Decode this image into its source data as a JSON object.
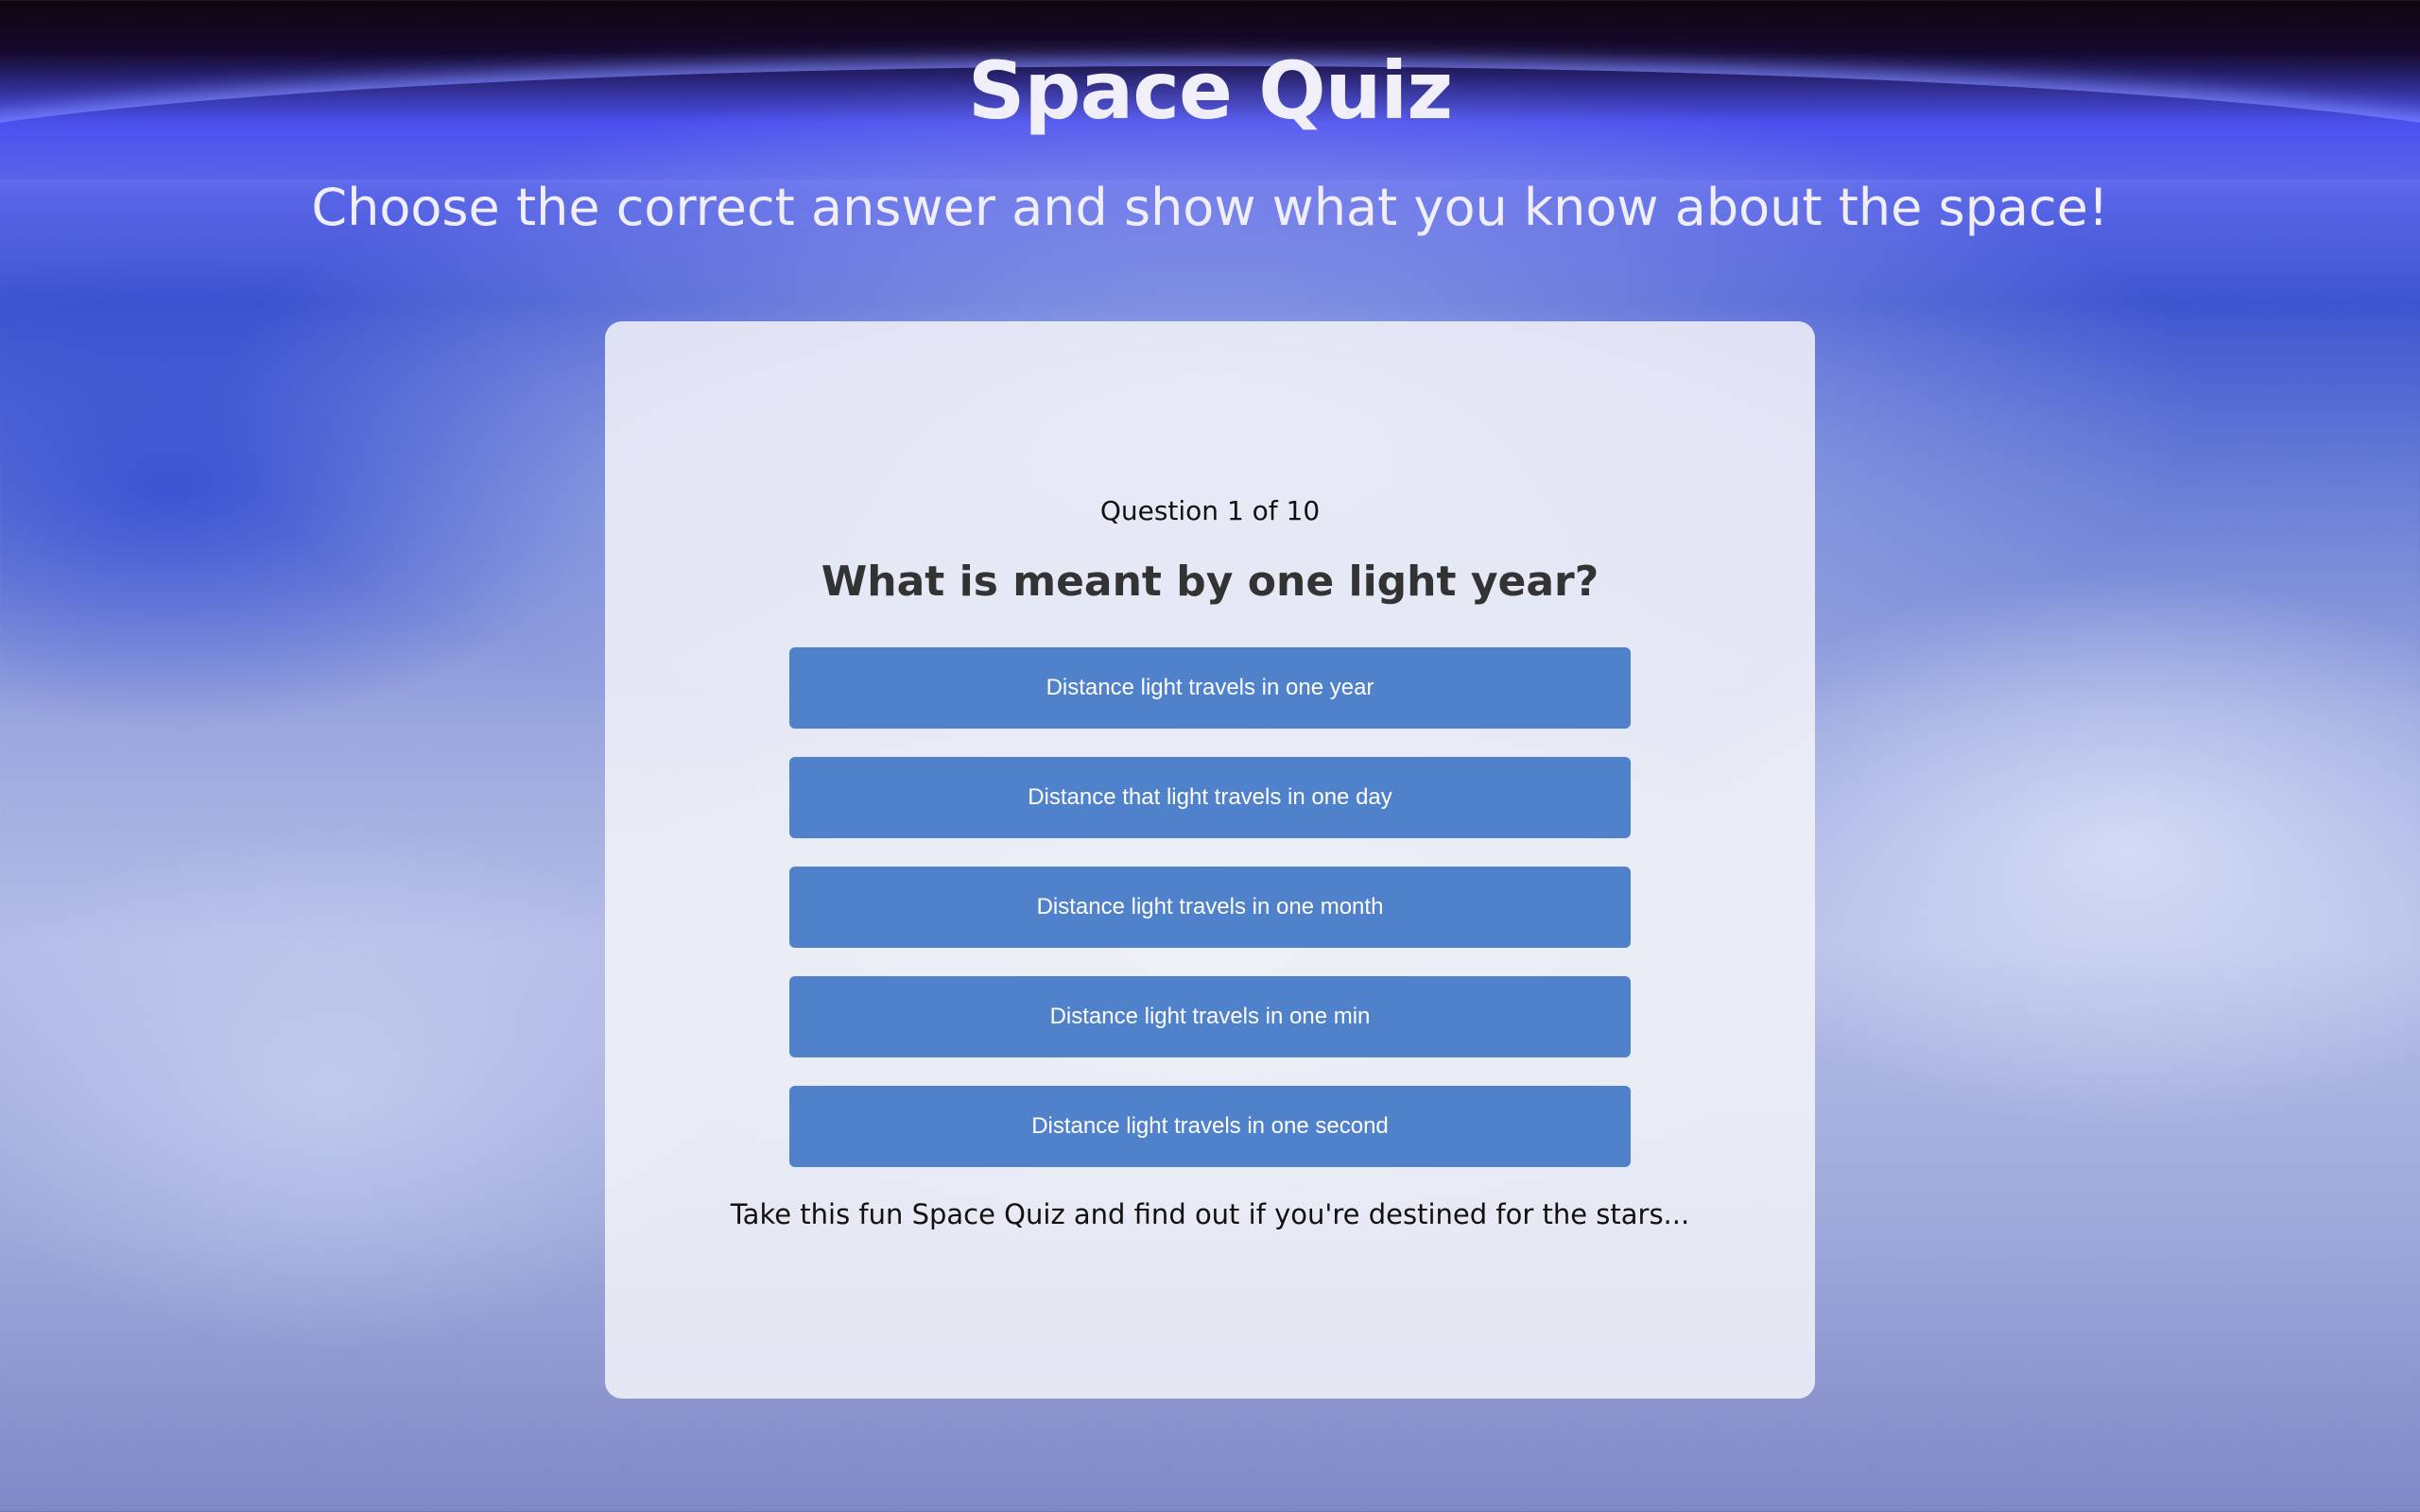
{
  "header": {
    "title": "Space Quiz",
    "subtitle": "Choose the correct answer and show what you know about the space!"
  },
  "quiz": {
    "progress": "Question 1 of 10",
    "question": "What is meant by one light year?",
    "answers": [
      "Distance light travels in one year",
      "Distance that light travels in one day",
      "Distance light travels in one month",
      "Distance light travels in one min",
      "Distance light travels in one second"
    ],
    "tagline": "Take this fun Space Quiz and find out if you're destined for the stars..."
  },
  "colors": {
    "answer_button": "#5082cc",
    "title_text": "#f0eef8",
    "card_background": "#f2f3f8"
  }
}
